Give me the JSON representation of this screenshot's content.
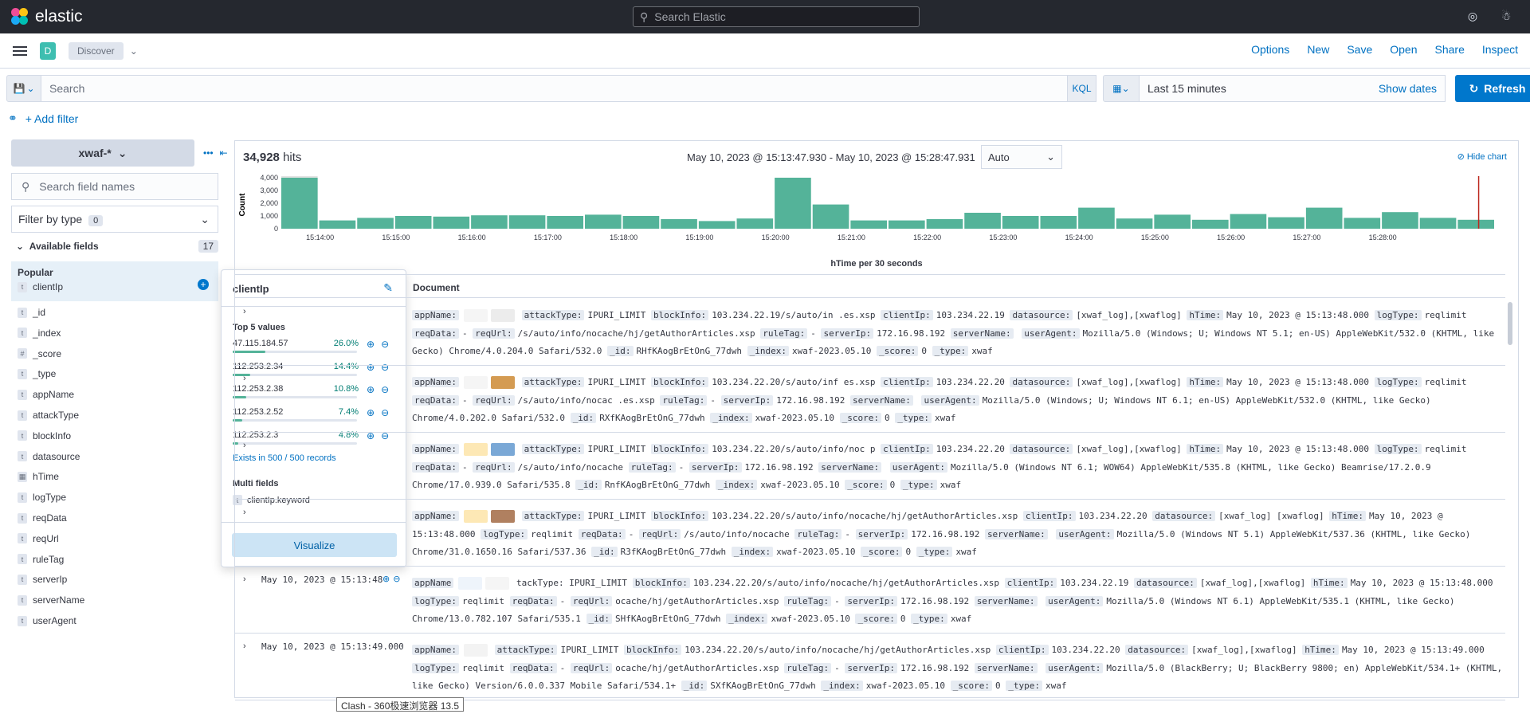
{
  "header": {
    "brand": "elastic",
    "search_placeholder": "Search Elastic",
    "icons": [
      "help-icon",
      "user-icon"
    ]
  },
  "appbar": {
    "space": "D",
    "breadcrumb": "Discover",
    "menu": [
      "Options",
      "New",
      "Save",
      "Open",
      "Share",
      "Inspect"
    ]
  },
  "query": {
    "placeholder": "Search",
    "language": "KQL",
    "time_label": "Last 15 minutes",
    "show_dates": "Show dates",
    "refresh": "Refresh",
    "add_filter": "+ Add filter"
  },
  "sidebar": {
    "index_pattern": "xwaf-*",
    "field_search_placeholder": "Search field names",
    "filter_by_type": "Filter by type",
    "filter_count": "0",
    "available_fields": "Available fields",
    "available_count": "17",
    "popular": "Popular",
    "popular_fields": [
      {
        "type": "t",
        "name": "clientIp"
      }
    ],
    "fields": [
      {
        "type": "t",
        "name": "_id"
      },
      {
        "type": "t",
        "name": "_index"
      },
      {
        "type": "#",
        "name": "_score"
      },
      {
        "type": "t",
        "name": "_type"
      },
      {
        "type": "t",
        "name": "appName"
      },
      {
        "type": "t",
        "name": "attackType"
      },
      {
        "type": "t",
        "name": "blockInfo"
      },
      {
        "type": "t",
        "name": "datasource"
      },
      {
        "type": "date",
        "name": "hTime"
      },
      {
        "type": "t",
        "name": "logType"
      },
      {
        "type": "t",
        "name": "reqData"
      },
      {
        "type": "t",
        "name": "reqUrl"
      },
      {
        "type": "t",
        "name": "ruleTag"
      },
      {
        "type": "t",
        "name": "serverIp"
      },
      {
        "type": "t",
        "name": "serverName"
      },
      {
        "type": "t",
        "name": "userAgent"
      }
    ]
  },
  "popover": {
    "title": "clientIp",
    "top5_label": "Top 5 values",
    "values": [
      {
        "value": "47.115.184.57",
        "percent": "26.0%",
        "fraction": 0.26
      },
      {
        "value": "112.253.2.34",
        "percent": "14.4%",
        "fraction": 0.144
      },
      {
        "value": "112.253.2.38",
        "percent": "10.8%",
        "fraction": 0.108
      },
      {
        "value": "112.253.2.52",
        "percent": "7.4%",
        "fraction": 0.074
      },
      {
        "value": "112.253.2.3",
        "percent": "4.8%",
        "fraction": 0.048
      }
    ],
    "exists": "Exists in 500 / 500 records",
    "multi_fields_label": "Multi fields",
    "multi_field": "clientIp.keyword",
    "visualize": "Visualize"
  },
  "results": {
    "hits_count": "34,928",
    "hits_label": "hits",
    "time_range": "May 10, 2023 @ 15:13:47.930 - May 10, 2023 @ 15:28:47.931",
    "interval": "Auto",
    "hide_chart": "Hide chart",
    "document_col": "Document",
    "rows": [
      {
        "ts": "",
        "text": [
          [
            "appName:",
            ""
          ],
          [
            "attackType:",
            "IPURI_LIMIT"
          ],
          [
            "blockInfo:",
            "103.234.22.19/s/auto/in"
          ],
          [
            "",
            ".es.xsp"
          ],
          [
            "clientIp:",
            "103.234.22.19"
          ],
          [
            "datasource:",
            "[xwaf_log],[xwaflog]"
          ],
          [
            "hTime:",
            "May 10, 2023 @ 15:13:48.000"
          ],
          [
            "logType:",
            "reqlimit"
          ],
          [
            "reqData:",
            "-"
          ],
          [
            "reqUrl:",
            "/s/auto/info/nocache/hj/getAuthorArticles.xsp"
          ],
          [
            "ruleTag:",
            "-"
          ],
          [
            "serverIp:",
            "172.16.98.192"
          ],
          [
            "serverName:",
            ""
          ],
          [
            "userAgent:",
            "Mozilla/5.0 (Windows; U; Windows NT 5.1; en-US) AppleWebKit/532.0 (KHTML, like Gecko) Chrome/4.0.204.0 Safari/532.0"
          ],
          [
            "_id:",
            "RHfKAogBrEtOnG_77dwh"
          ],
          [
            "_index:",
            "xwaf-2023.05.10"
          ],
          [
            "_score:",
            "0"
          ],
          [
            "_type:",
            "xwaf"
          ]
        ]
      },
      {
        "ts": "",
        "text": [
          [
            "appName:",
            ""
          ],
          [
            "attackType:",
            "IPURI_LIMIT"
          ],
          [
            "blockInfo:",
            "103.234.22.20/s/auto/inf"
          ],
          [
            "",
            "es.xsp"
          ],
          [
            "clientIp:",
            "103.234.22.20"
          ],
          [
            "datasource:",
            "[xwaf_log],[xwaflog]"
          ],
          [
            "hTime:",
            "May 10, 2023 @ 15:13:48.000"
          ],
          [
            "logType:",
            "reqlimit"
          ],
          [
            "reqData:",
            "-"
          ],
          [
            "reqUrl:",
            "/s/auto/info/nocac      .es.xsp"
          ],
          [
            "ruleTag:",
            "-"
          ],
          [
            "serverIp:",
            "172.16.98.192"
          ],
          [
            "serverName:",
            ""
          ],
          [
            "userAgent:",
            "Mozilla/5.0 (Windows; U; Windows NT 6.1; en-US) AppleWebKit/532.0 (KHTML, like Gecko) Chrome/4.0.202.0 Safari/532.0"
          ],
          [
            "_id:",
            "RXfKAogBrEtOnG_77dwh"
          ],
          [
            "_index:",
            "xwaf-2023.05.10"
          ],
          [
            "_score:",
            "0"
          ],
          [
            "_type:",
            "xwaf"
          ]
        ]
      },
      {
        "ts": "",
        "text": [
          [
            "appName:",
            ""
          ],
          [
            "attackType:",
            "IPURI_LIMIT"
          ],
          [
            "blockInfo:",
            "103.234.22.20/s/auto/info/noc"
          ],
          [
            "",
            "p"
          ],
          [
            "clientIp:",
            "103.234.22.20"
          ],
          [
            "datasource:",
            "[xwaf_log],[xwaflog]"
          ],
          [
            "hTime:",
            "May 10, 2023 @ 15:13:48.000"
          ],
          [
            "logType:",
            "reqlimit"
          ],
          [
            "reqData:",
            "-"
          ],
          [
            "reqUrl:",
            "/s/auto/info/nocache"
          ],
          [
            "ruleTag:",
            "-"
          ],
          [
            "serverIp:",
            "172.16.98.192"
          ],
          [
            "serverName:",
            ""
          ],
          [
            "userAgent:",
            "Mozilla/5.0 (Windows NT 6.1; WOW64) AppleWebKit/535.8 (KHTML, like Gecko) Beamrise/17.2.0.9 Chrome/17.0.939.0 Safari/535.8"
          ],
          [
            "_id:",
            "RnfKAogBrEtOnG_77dwh"
          ],
          [
            "_index:",
            "xwaf-2023.05.10"
          ],
          [
            "_score:",
            "0"
          ],
          [
            "_type:",
            "xwaf"
          ]
        ]
      },
      {
        "ts": "",
        "text": [
          [
            "appName:",
            ""
          ],
          [
            "attackType:",
            "IPURI_LIMIT"
          ],
          [
            "blockInfo:",
            "103.234.22.20/s/auto/info/nocache/hj/getAuthorArticles.xsp"
          ],
          [
            "clientIp:",
            "103.234.22.20"
          ],
          [
            "datasource:",
            "[xwaf_log]"
          ],
          [
            "",
            "[xwaflog]"
          ],
          [
            "hTime:",
            "May 10, 2023 @ 15:13:48.000"
          ],
          [
            "logType:",
            "reqlimit"
          ],
          [
            "reqData:",
            "-"
          ],
          [
            "reqUrl:",
            "/s/auto/info/nocache"
          ],
          [
            "ruleTag:",
            "-"
          ],
          [
            "serverIp:",
            "172.16.98.192"
          ],
          [
            "serverName:",
            ""
          ],
          [
            "userAgent:",
            "Mozilla/5.0 (Windows NT 5.1) AppleWebKit/537.36 (KHTML, like Gecko) Chrome/31.0.1650.16 Safari/537.36"
          ],
          [
            "_id:",
            "R3fKAogBrEtOnG_77dwh"
          ],
          [
            "_index:",
            "xwaf-2023.05.10"
          ],
          [
            "_score:",
            "0"
          ],
          [
            "_type:",
            "xwaf"
          ]
        ]
      },
      {
        "ts": "May 10, 2023 @ 15:13:48",
        "text": [
          [
            "appName",
            ""
          ],
          [
            "",
            "tackType: IPURI_LIMIT"
          ],
          [
            "blockInfo:",
            "103.234.22.20/s/auto/info/nocache/hj/getAuthorArticles.xsp"
          ],
          [
            "clientIp:",
            "103.234.22.19"
          ],
          [
            "datasource:",
            "[xwaf_log],[xwaflog]"
          ],
          [
            "hTime:",
            "May 10, 2023 @ 15:13:48.000"
          ],
          [
            "logType:",
            "reqlimit"
          ],
          [
            "reqData:",
            "-"
          ],
          [
            "reqUrl:",
            "ocache/hj/getAuthorArticles.xsp"
          ],
          [
            "ruleTag:",
            "-"
          ],
          [
            "serverIp:",
            "172.16.98.192"
          ],
          [
            "serverName:",
            ""
          ],
          [
            "userAgent:",
            "Mozilla/5.0 (Windows NT 6.1) AppleWebKit/535.1 (KHTML, like Gecko) Chrome/13.0.782.107 Safari/535.1"
          ],
          [
            "_id:",
            "SHfKAogBrEtOnG_77dwh"
          ],
          [
            "_index:",
            "xwaf-2023.05.10"
          ],
          [
            "_score:",
            "0"
          ],
          [
            "_type:",
            "xwaf"
          ]
        ]
      },
      {
        "ts": "May 10, 2023 @ 15:13:49.000",
        "text": [
          [
            "appName:",
            ""
          ],
          [
            "attackType:",
            "IPURI_LIMIT"
          ],
          [
            "blockInfo:",
            "103.234.22.20/s/auto/info/nocache/hj/getAuthorArticles.xsp"
          ],
          [
            "clientIp:",
            "103.234.22.20"
          ],
          [
            "datasource:",
            "[xwaf_log],[xwaflog]"
          ],
          [
            "hTime:",
            "May 10, 2023 @ 15:13:49.000"
          ],
          [
            "logType:",
            "reqlimit"
          ],
          [
            "reqData:",
            "-"
          ],
          [
            "reqUrl:",
            "ocache/hj/getAuthorArticles.xsp"
          ],
          [
            "ruleTag:",
            "-"
          ],
          [
            "serverIp:",
            "172.16.98.192"
          ],
          [
            "serverName:",
            ""
          ],
          [
            "userAgent:",
            "Mozilla/5.0 (BlackBerry; U; BlackBerry 9800; en) AppleWebKit/534.1+ (KHTML, like Gecko) Version/6.0.0.337 Mobile Safari/534.1+"
          ],
          [
            "_id:",
            "SXfKAogBrEtOnG_77dwh"
          ],
          [
            "_index:",
            "xwaf-2023.05.10"
          ],
          [
            "_score:",
            "0"
          ],
          [
            "_type:",
            "xwaf"
          ]
        ]
      }
    ]
  },
  "chart_data": {
    "type": "bar",
    "title": "",
    "xlabel": "hTime per 30 seconds",
    "ylabel": "Count",
    "ylim": [
      0,
      4000
    ],
    "yticks": [
      "0",
      "1,000",
      "2,000",
      "3,000",
      "4,000"
    ],
    "xticks": [
      "15:14:00",
      "15:15:00",
      "15:16:00",
      "15:17:00",
      "15:18:00",
      "15:19:00",
      "15:20:00",
      "15:21:00",
      "15:22:00",
      "15:23:00",
      "15:24:00",
      "15:25:00",
      "15:26:00",
      "15:27:00",
      "15:28:00"
    ],
    "values": [
      4000,
      650,
      850,
      1000,
      950,
      1050,
      1050,
      1000,
      1100,
      1000,
      750,
      600,
      800,
      4000,
      1900,
      650,
      650,
      750,
      1250,
      1000,
      1000,
      1650,
      800,
      1100,
      700,
      1150,
      900,
      1650,
      850,
      1300,
      850,
      700
    ],
    "partial_buckets": [
      0
    ],
    "bar_color": "#54b399",
    "marker_color": "#bd271e"
  },
  "tooltip": "Clash - 360极速浏览器 13.5"
}
